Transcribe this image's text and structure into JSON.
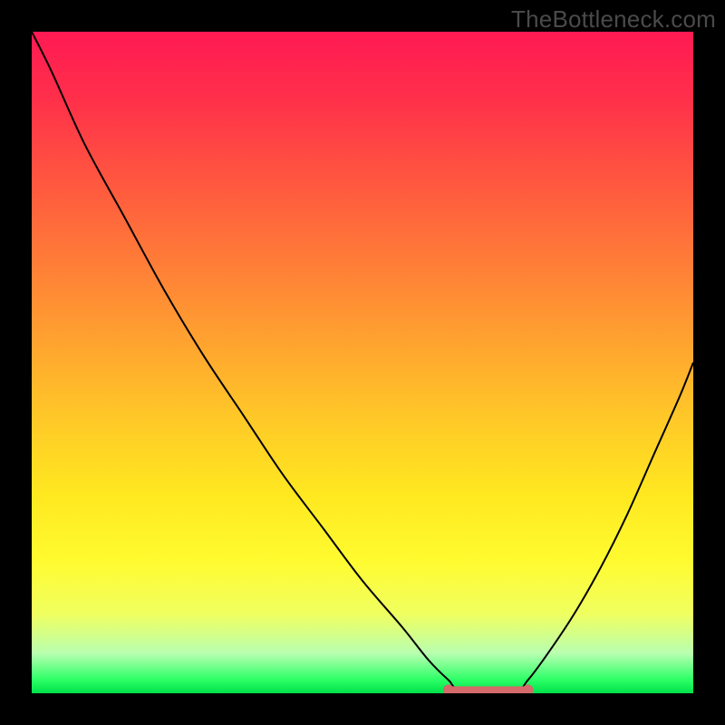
{
  "watermark": "TheBottleneck.com",
  "colors": {
    "background": "#000000",
    "curve_stroke": "#000000",
    "flat_segment": "#d46a6a",
    "flat_endpoints": "#d46a6a",
    "gradient_top": "#ff1a53",
    "gradient_bottom": "#00e04a"
  },
  "chart_data": {
    "type": "line",
    "title": "",
    "xlabel": "",
    "ylabel": "",
    "xlim": [
      0,
      100
    ],
    "ylim": [
      0,
      100
    ],
    "grid": false,
    "legend": false,
    "x": [
      0,
      3,
      8,
      14,
      20,
      26,
      32,
      38,
      44,
      50,
      56,
      60,
      63,
      65,
      73,
      75,
      78,
      82,
      86,
      90,
      94,
      98,
      100
    ],
    "values": [
      100,
      94,
      83,
      72,
      61,
      51,
      42,
      33,
      25,
      17,
      10,
      5,
      2,
      0.5,
      0.5,
      2,
      6,
      12,
      19,
      27,
      36,
      45,
      50
    ],
    "flat_segment": {
      "x_start": 63,
      "x_end": 75,
      "y": 0.5
    }
  }
}
